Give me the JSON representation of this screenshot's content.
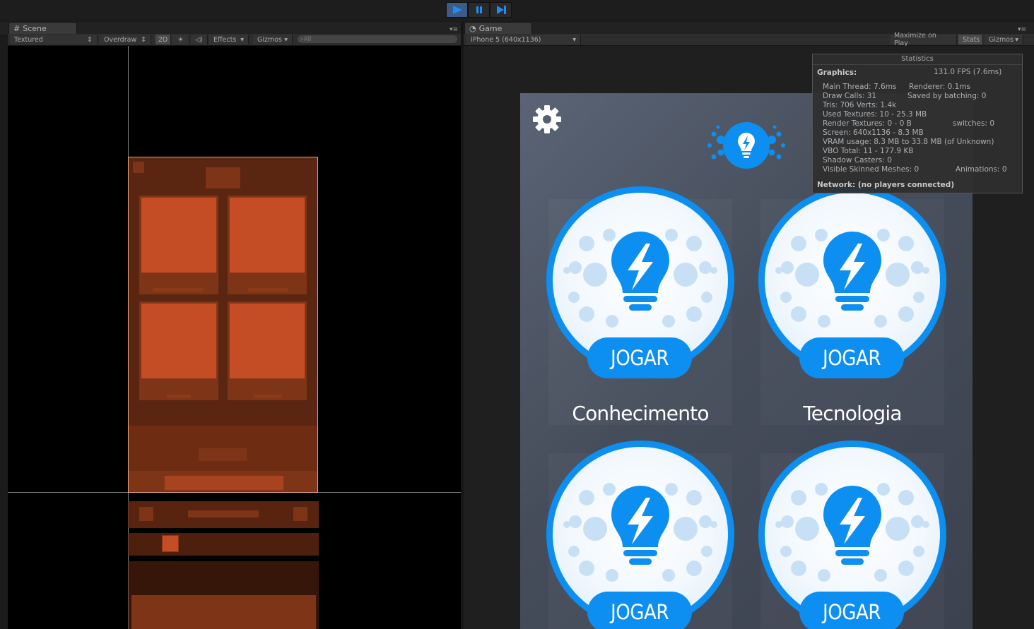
{
  "toolbar": {
    "play_icon": "play-icon",
    "pause_icon": "pause-icon",
    "step_icon": "step-icon",
    "accent": "#3e5a86"
  },
  "scene": {
    "tab_label": "Scene",
    "shading_mode": "Textured",
    "render_mode": "Overdraw",
    "mode_2d": "2D",
    "effects_label": "Effects",
    "gizmos_label": "Gizmos",
    "search_placeholder": "All"
  },
  "game": {
    "tab_label": "Game",
    "resolution": "iPhone 5 (640x1136)",
    "maximize_label": "Maximize on Play",
    "stats_label": "Stats",
    "gizmos_label": "Gizmos"
  },
  "stats": {
    "title": "Statistics",
    "graphics_label": "Graphics:",
    "fps": "131.0 FPS (7.6ms)",
    "main_thread": "Main Thread: 7.6ms",
    "renderer": "Renderer: 0.1ms",
    "draw_calls": "Draw Calls: 31",
    "saved_batching": "Saved by batching: 0",
    "tris_verts": "Tris: 706  Verts: 1.4k",
    "used_textures": "Used Textures: 10 - 25.3 MB",
    "render_textures": "Render Textures: 0 - 0 B",
    "switches": "switches: 0",
    "screen": "Screen: 640x1136 - 8.3 MB",
    "vram": "VRAM usage: 8.3 MB to 33.8 MB (of Unknown)",
    "vbo": "VBO Total: 11 - 177.9 KB",
    "shadow_casters": "Shadow Casters: 0",
    "skinned_meshes": "Visible Skinned Meshes: 0",
    "animations": "Animations: 0",
    "network": "Network: (no players connected)"
  },
  "app": {
    "button_color": "#0c8ff0",
    "categories": [
      {
        "name": "Conhecimento",
        "button": "JOGAR"
      },
      {
        "name": "Tecnologia",
        "button": "JOGAR"
      },
      {
        "name": "",
        "button": "JOGAR"
      },
      {
        "name": "",
        "button": "JOGAR"
      }
    ]
  }
}
